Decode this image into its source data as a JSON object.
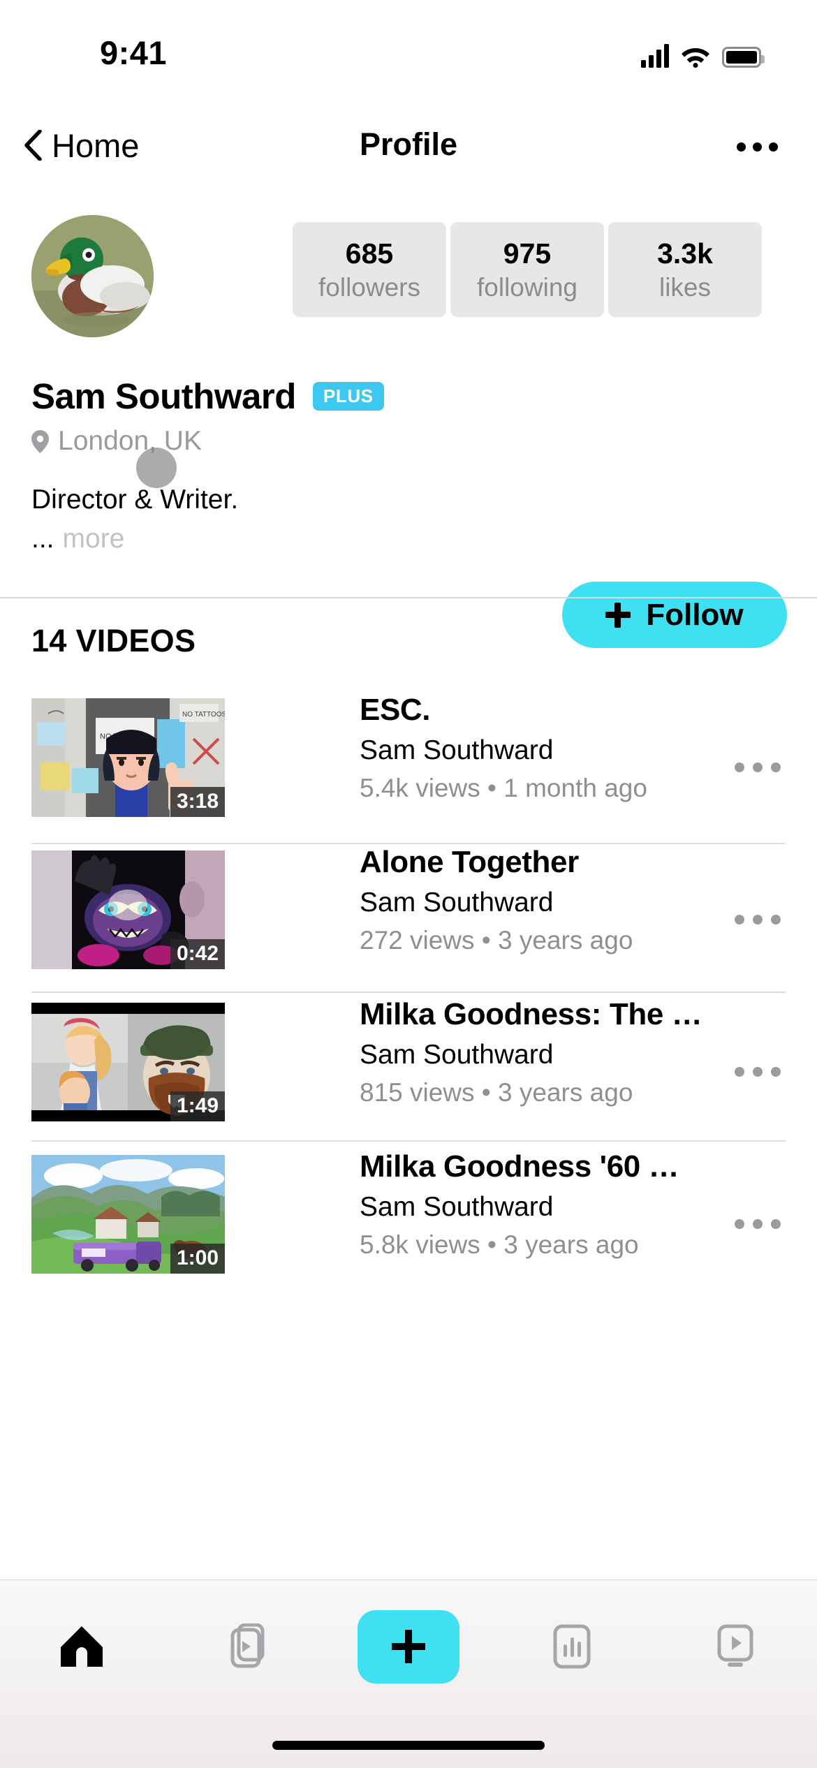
{
  "status_bar": {
    "time": "9:41",
    "signal_icon": "cellular-bars-icon",
    "wifi_icon": "wifi-icon",
    "battery_icon": "battery-full-icon"
  },
  "nav": {
    "back_label": "Home",
    "back_icon": "chevron-left-icon",
    "title": "Profile",
    "more_icon": "overflow-menu-icon"
  },
  "profile": {
    "avatar_icon": "duck-avatar",
    "name": "Sam Southward",
    "badge": "PLUS",
    "location": "London, UK",
    "location_icon": "map-pin-icon",
    "bio": "Director & Writer.",
    "bio_ellipsis": "...",
    "more_label": "more",
    "follow_label": "Follow",
    "follow_icon": "plus-icon",
    "stats": [
      {
        "value": "685",
        "label": "followers"
      },
      {
        "value": "975",
        "label": "following"
      },
      {
        "value": "3.3k",
        "label": "likes"
      }
    ]
  },
  "videos_section": {
    "heading": "14 VIDEOS",
    "items": [
      {
        "title": "ESC.",
        "author": "Sam Southward",
        "meta": "5.4k views • 1 month ago",
        "duration": "3:18",
        "thumb": "esc-thumbnail"
      },
      {
        "title": "Alone Together",
        "author": "Sam Southward",
        "meta": "272 views • 3 years ago",
        "duration": "0:42",
        "thumb": "alone-together-thumbnail"
      },
      {
        "title": "Milka Goodness: The …",
        "author": "Sam Southward",
        "meta": "815 views • 3 years ago",
        "duration": "1:49",
        "thumb": "milka-the-thumbnail"
      },
      {
        "title": "Milka Goodness '60 …",
        "author": "Sam Southward",
        "meta": "5.8k views • 3 years ago",
        "duration": "1:00",
        "thumb": "milka-60-thumbnail"
      }
    ]
  },
  "tab_bar": {
    "tabs": [
      {
        "name": "home-tab",
        "icon": "home-icon",
        "active": true
      },
      {
        "name": "library-tab",
        "icon": "video-stack-icon",
        "active": false
      },
      {
        "name": "create-tab",
        "icon": "plus-icon",
        "active": false
      },
      {
        "name": "analytics-tab",
        "icon": "bar-chart-icon",
        "active": false
      },
      {
        "name": "watch-tab",
        "icon": "tv-play-icon",
        "active": false
      }
    ]
  },
  "colors": {
    "accent": "#3FE0F2",
    "badge": "#3EC8F0",
    "pill_bg": "#E7E7E8",
    "muted_text": "#8E8E93"
  }
}
